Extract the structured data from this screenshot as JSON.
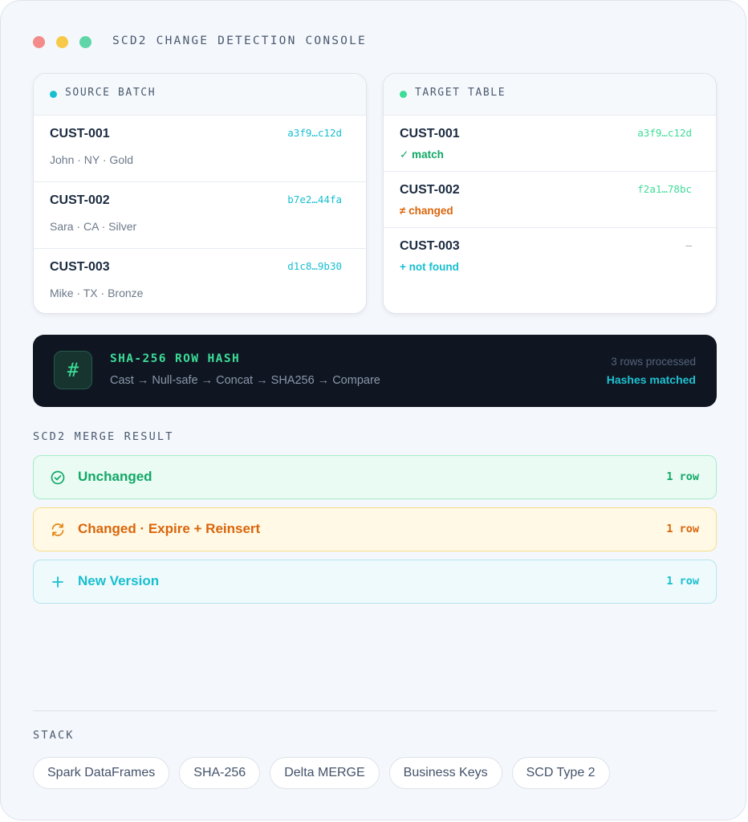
{
  "window": {
    "title": "SCD2 CHANGE DETECTION CONSOLE",
    "controls": [
      "close-icon",
      "minimize-icon",
      "maximize-icon"
    ]
  },
  "source": {
    "title": "SOURCE BATCH",
    "accent": "#17bfd0",
    "rows": [
      {
        "key": "CUST-001",
        "hash": "a3f9…c12d",
        "detail": "John · NY · Gold"
      },
      {
        "key": "CUST-002",
        "hash": "b7e2…44fa",
        "detail": "Sara · CA · Silver"
      },
      {
        "key": "CUST-003",
        "hash": "d1c8…9b30",
        "detail": "Mike · TX · Bronze"
      }
    ]
  },
  "target": {
    "title": "TARGET TABLE",
    "accent": "#3ddc97",
    "rows": [
      {
        "key": "CUST-001",
        "hash": "a3f9…c12d",
        "status": "✓ match",
        "status_color": "#11a866"
      },
      {
        "key": "CUST-002",
        "hash": "f2a1…78bc",
        "status": "≠ changed",
        "status_color": "#d9650b"
      },
      {
        "key": "CUST-003",
        "hash": "—",
        "status": "+ not found",
        "status_color": "#17bfd0"
      }
    ]
  },
  "hash": {
    "icon": "hash-icon",
    "title": "SHA-256 ROW HASH",
    "steps": "Cast → Null-safe → Concat → SHA256 → Compare",
    "count": "3 rows processed",
    "result": "Hashes matched"
  },
  "merge": {
    "title": "SCD2 MERGE RESULT",
    "results": [
      {
        "icon": "check-circle-icon",
        "label": "Unchanged",
        "count": "1 row",
        "color": "#11a866"
      },
      {
        "icon": "refresh-icon",
        "label": "Changed · Expire + Reinsert",
        "count": "1 row",
        "color": "#d9650b"
      },
      {
        "icon": "plus-icon",
        "label": "New Version",
        "count": "1 row",
        "color": "#17bfd0"
      }
    ]
  },
  "stack": {
    "title": "STACK",
    "items": [
      "Spark DataFrames",
      "SHA-256",
      "Delta MERGE",
      "Business Keys",
      "SCD Type 2"
    ]
  }
}
